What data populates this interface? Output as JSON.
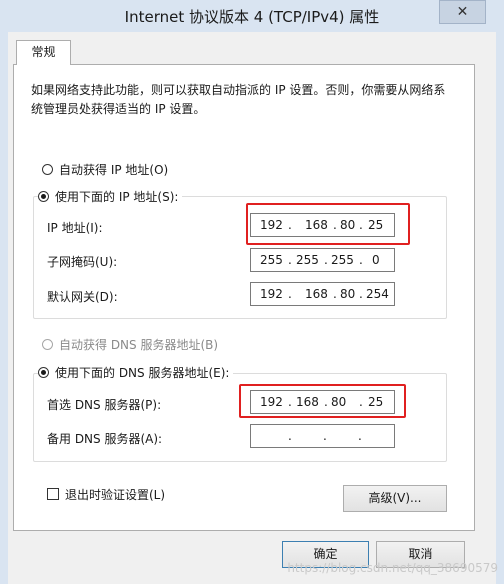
{
  "window": {
    "title": "Internet 协议版本 4 (TCP/IPv4) 属性",
    "close_glyph": "✕"
  },
  "tab": {
    "label": "常规"
  },
  "description": "如果网络支持此功能，则可以获取自动指派的 IP 设置。否则，你需要从网络系统管理员处获得适当的 IP 设置。",
  "ip": {
    "auto_radio": "自动获得 IP 地址(O)",
    "manual_radio": "使用下面的 IP 地址(S):",
    "address_label": "IP 地址(I):",
    "address": [
      "192",
      "168",
      "80",
      "25"
    ],
    "mask_label": "子网掩码(U):",
    "mask": [
      "255",
      "255",
      "255",
      "0"
    ],
    "gateway_label": "默认网关(D):",
    "gateway": [
      "192",
      "168",
      "80",
      "254"
    ]
  },
  "dns": {
    "auto_radio": "自动获得 DNS 服务器地址(B)",
    "manual_radio": "使用下面的 DNS 服务器地址(E):",
    "preferred_label": "首选 DNS 服务器(P):",
    "preferred": [
      "192",
      "168",
      "80",
      "25"
    ],
    "alternate_label": "备用 DNS 服务器(A):",
    "alternate": [
      "",
      "",
      "",
      ""
    ]
  },
  "validate_checkbox": "退出时验证设置(L)",
  "advanced_button": "高级(V)...",
  "ok_button": "确定",
  "cancel_button": "取消",
  "watermark": "https://blog.csdn.net/qq_38690579",
  "colors": {
    "highlight": "#e02020",
    "window_frame": "#d9e4f1"
  }
}
